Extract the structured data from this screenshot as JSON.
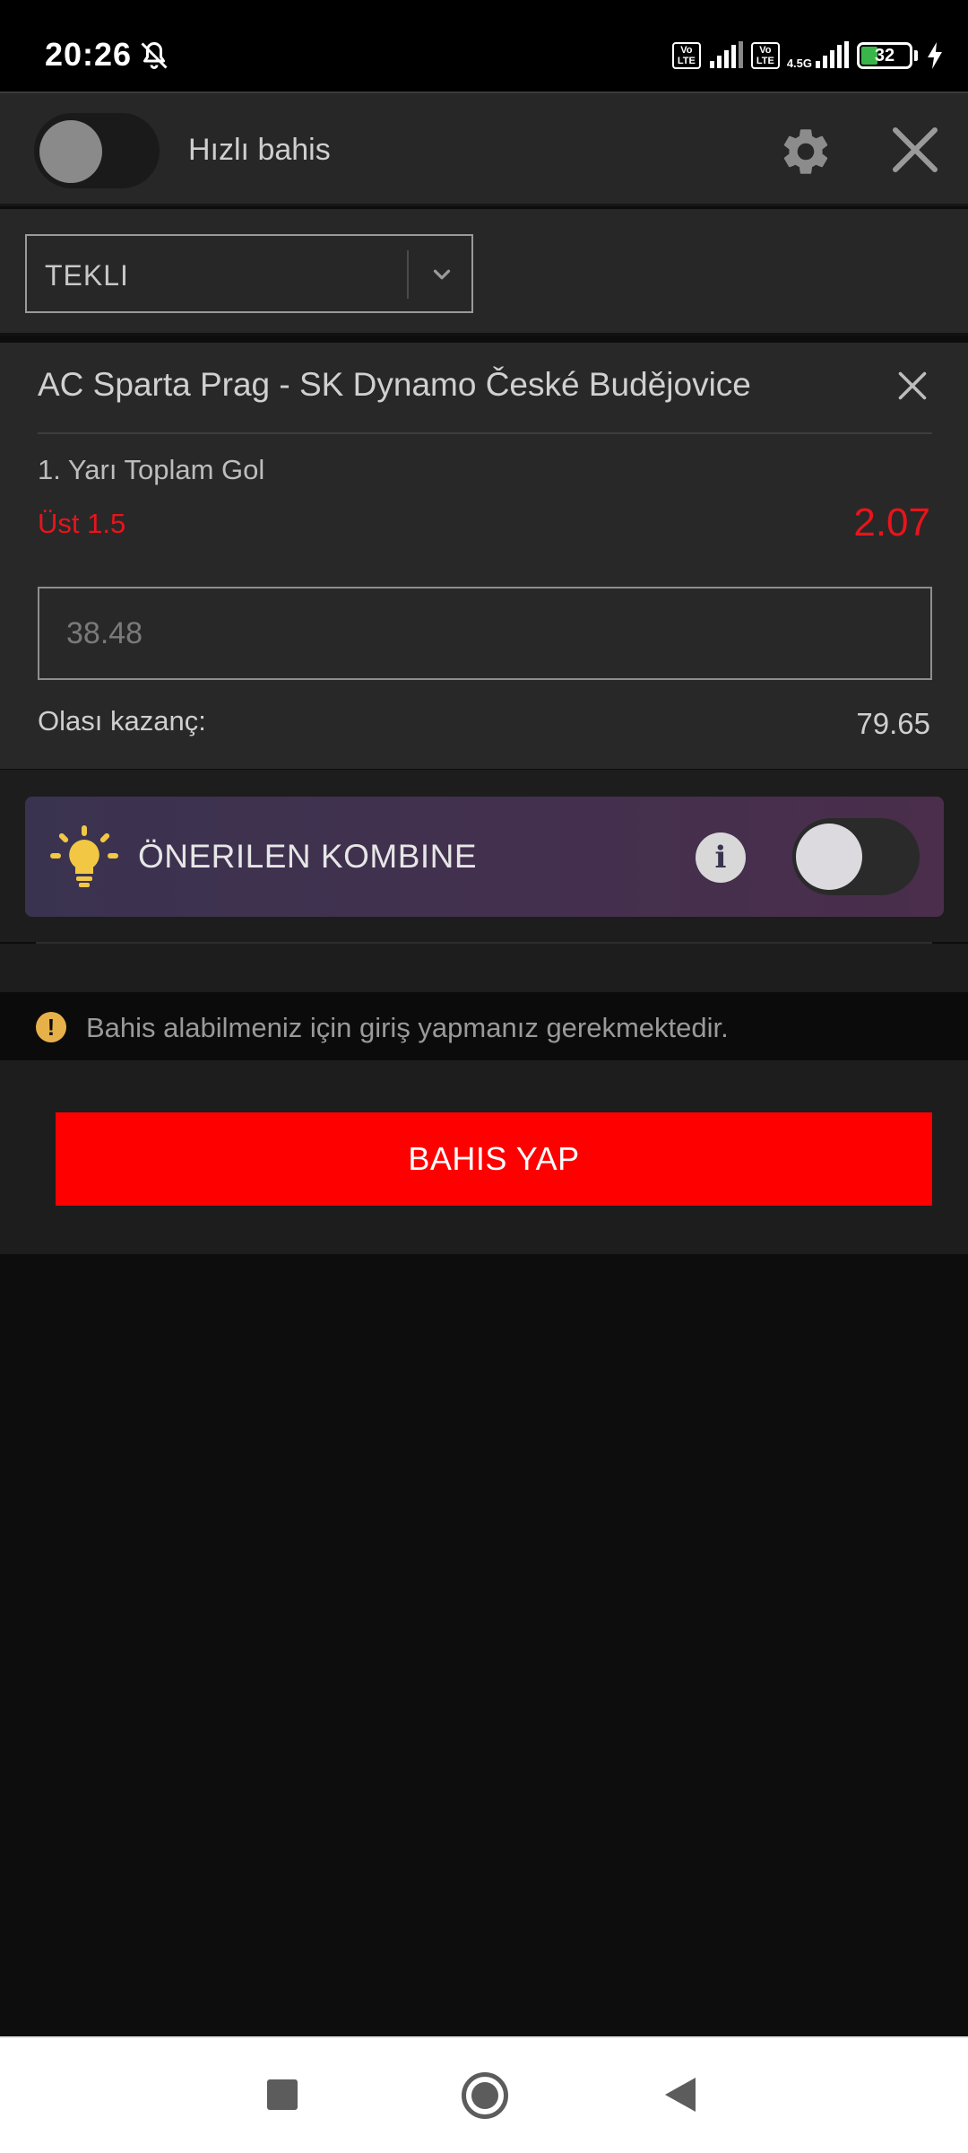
{
  "status_bar": {
    "time": "20:26",
    "volte_1": "Vo LTE",
    "volte_2": "Vo LTE",
    "network_type": "4.5G",
    "battery_level": "32",
    "battery_fraction": 0.32,
    "battery_color": "#39b54a",
    "icons": [
      "bell-off-icon",
      "signal-icon",
      "charging-icon"
    ]
  },
  "header": {
    "quick_bet_label": "Hızlı bahis",
    "quick_bet_enabled": false,
    "settings_icon": "gear-icon",
    "close_icon": "close-icon"
  },
  "bet_type": {
    "selected": "TEKLI",
    "icon": "chevron-down-icon"
  },
  "bet": {
    "match": "AC Sparta Prag - SK Dynamo České Budějovice",
    "market": "1. Yarı Toplam Gol",
    "selection": "Üst 1.5",
    "odds": "2.07",
    "stake_placeholder": "38.48",
    "possible_win_label": "Olası kazanç:",
    "possible_win_value": "79.65",
    "accent_color": "#e8141b"
  },
  "combo": {
    "label": "ÖNERILEN KOMBINE",
    "info_glyph": "i",
    "enabled": false,
    "icon": "lightbulb-icon"
  },
  "notice": {
    "icon_glyph": "!",
    "text": "Bahis alabilmeniz için giriş yapmanız gerekmektedir."
  },
  "actions": {
    "place_bet_label": "BAHIS YAP",
    "place_bet_color": "#ff0000"
  },
  "nav": {
    "icons": [
      "recents-icon",
      "home-icon",
      "back-icon"
    ]
  }
}
